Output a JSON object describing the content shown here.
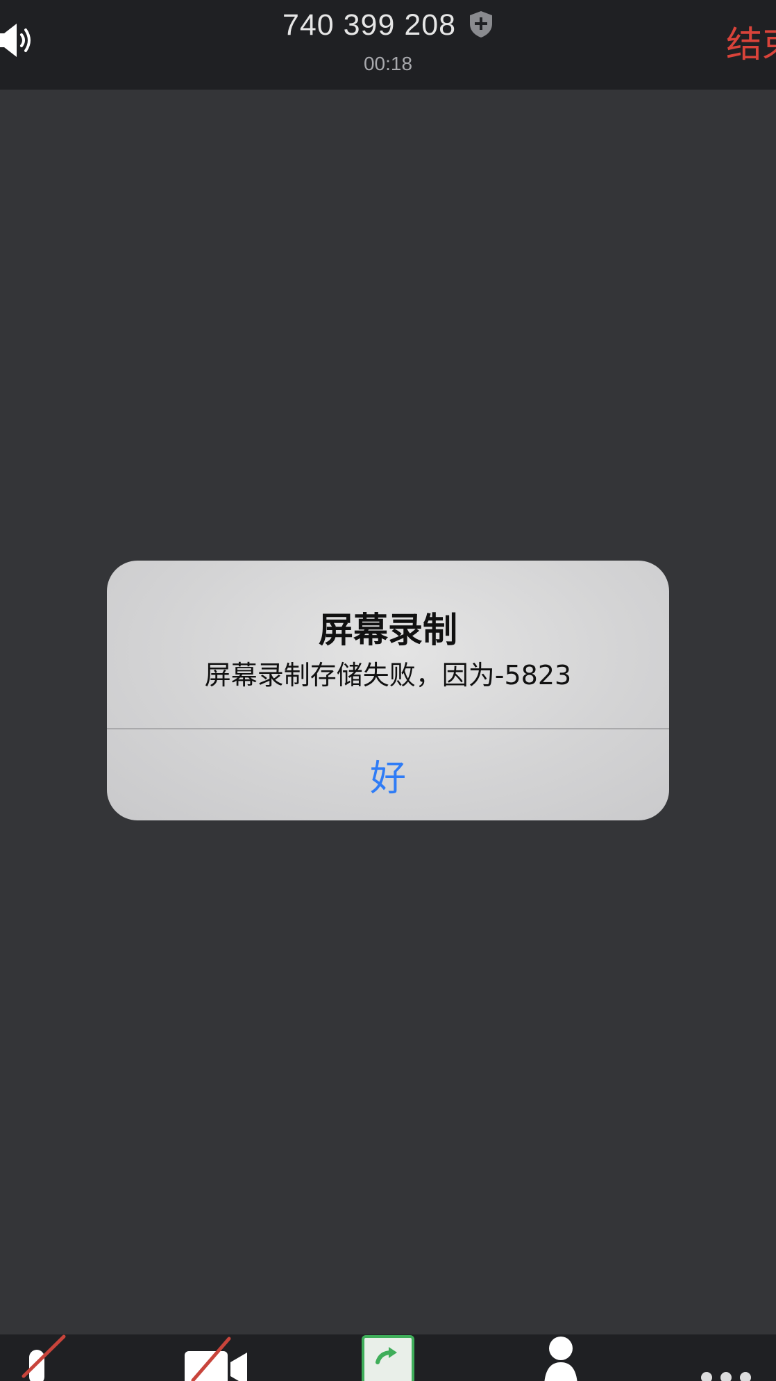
{
  "topbar": {
    "meeting_id": "740 399 208",
    "timer": "00:18",
    "end_label": "结束",
    "icons": {
      "speaker": "speaker-icon",
      "security": "shield-icon"
    }
  },
  "alert": {
    "title": "屏幕录制",
    "message": "屏幕录制存储失败，因为-5823",
    "ok_label": "好"
  },
  "toolbar": {
    "items": [
      {
        "name": "mute-audio",
        "icon": "microphone-off-icon"
      },
      {
        "name": "stop-video",
        "icon": "video-camera-off-icon"
      },
      {
        "name": "share-screen",
        "icon": "share-arrow-icon"
      },
      {
        "name": "participants",
        "icon": "person-icon"
      },
      {
        "name": "more",
        "icon": "more-dots-icon"
      }
    ]
  },
  "colors": {
    "background": "#343538",
    "bar": "#1f2023",
    "end": "#d9433a",
    "alert_button": "#2f7cf6",
    "share_green": "#3fae5a",
    "muted_red": "#c8443b"
  }
}
